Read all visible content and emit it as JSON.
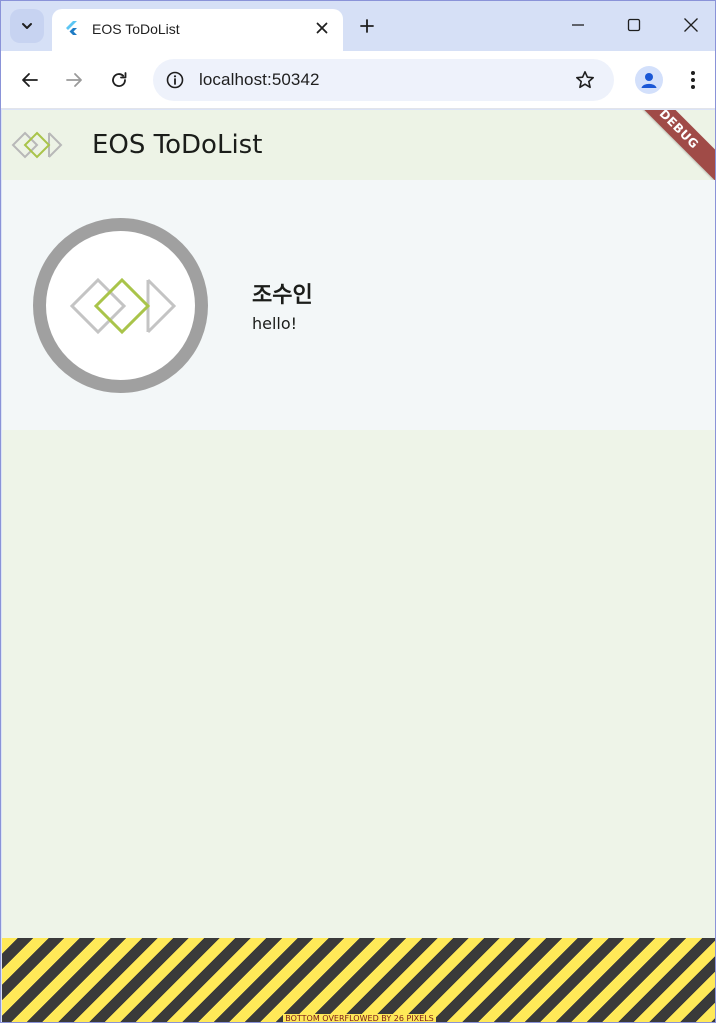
{
  "browser": {
    "tab_title": "EOS ToDoList",
    "url": "localhost:50342"
  },
  "app": {
    "title": "EOS ToDoList",
    "debug_banner": "DEBUG",
    "profile": {
      "name": "조수인",
      "status": "hello!"
    },
    "overflow_warning": "BOTTOM OVERFLOWED BY 26 PIXELS"
  },
  "colors": {
    "app_background": "#eef4e8",
    "card_background": "#f3f7f8",
    "logo_gray": "#b5b5b5",
    "logo_green": "#a9c44a",
    "avatar_ring": "#a0a0a0",
    "debug_banner": "#a04b47"
  }
}
